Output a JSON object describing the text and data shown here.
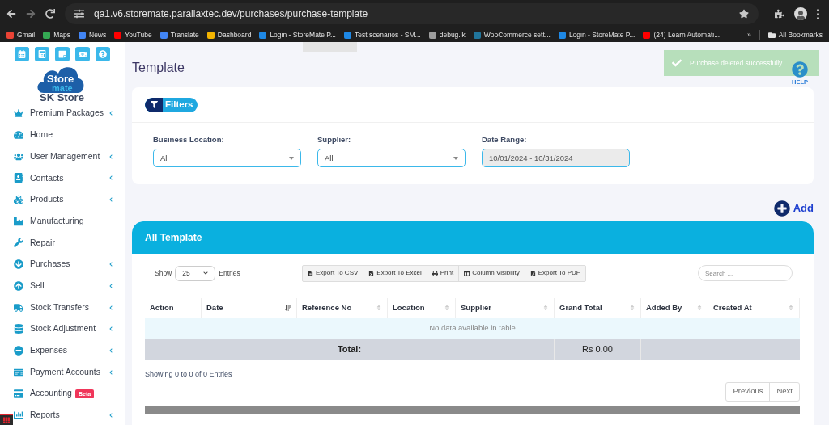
{
  "browser": {
    "url": "qa1.v6.storemate.parallaxtec.dev/purchases/purchase-template",
    "bookmarks": [
      {
        "label": "Gmail",
        "color": "#ea4335"
      },
      {
        "label": "Maps",
        "color": "#34a853"
      },
      {
        "label": "News",
        "color": "#4285f4"
      },
      {
        "label": "YouTube",
        "color": "#ff0000"
      },
      {
        "label": "Translate",
        "color": "#4285f4"
      },
      {
        "label": "Dashboard",
        "color": "#f4b400"
      },
      {
        "label": "Login - StoreMate P...",
        "color": "#1e88e5"
      },
      {
        "label": "Test scenarios - SM...",
        "color": "#1e88e5"
      },
      {
        "label": "debug.lk",
        "color": "#9e9e9e"
      },
      {
        "label": "WooCommerce sett...",
        "color": "#21759b"
      },
      {
        "label": "Login - StoreMate P...",
        "color": "#1e88e5"
      },
      {
        "label": "(24) Learn Automati...",
        "color": "#ff0000"
      }
    ],
    "more": "»",
    "all_bookmarks": "All Bookmarks"
  },
  "sidebar": {
    "logo_top": "Store",
    "logo_bottom": "mate",
    "store_name": "SK Store",
    "items": [
      {
        "label": "Premium Packages",
        "has_submenu": true
      },
      {
        "label": "Home",
        "has_submenu": false
      },
      {
        "label": "User Management",
        "has_submenu": true
      },
      {
        "label": "Contacts",
        "has_submenu": true
      },
      {
        "label": "Products",
        "has_submenu": true
      },
      {
        "label": "Manufacturing",
        "has_submenu": false
      },
      {
        "label": "Repair",
        "has_submenu": false
      },
      {
        "label": "Purchases",
        "has_submenu": true
      },
      {
        "label": "Sell",
        "has_submenu": true
      },
      {
        "label": "Stock Transfers",
        "has_submenu": true
      },
      {
        "label": "Stock Adjustment",
        "has_submenu": true
      },
      {
        "label": "Expenses",
        "has_submenu": true
      },
      {
        "label": "Payment Accounts",
        "has_submenu": true
      },
      {
        "label": "Accounting",
        "has_submenu": false,
        "badge": "Beta"
      },
      {
        "label": "Reports",
        "has_submenu": true
      }
    ]
  },
  "page_title": "Template",
  "toast": {
    "message": "Purchase deleted successfully"
  },
  "help": "HELP",
  "filters": {
    "button": "Filters",
    "fields": [
      {
        "label": "Business Location:",
        "value": "All",
        "kind": "select"
      },
      {
        "label": "Supplier:",
        "value": "All",
        "kind": "select"
      },
      {
        "label": "Date Range:",
        "value": "10/01/2024 - 10/31/2024",
        "kind": "readonly"
      }
    ]
  },
  "add_button": "Add",
  "table_card": {
    "title": "All Template",
    "show_label": "Show",
    "page_size": "25",
    "entries_label": "Entries",
    "exports": [
      "Export To CSV",
      "Export To Excel",
      "Print",
      "Column Visibility",
      "Export To PDF"
    ],
    "search_placeholder": "Search ...",
    "columns": [
      {
        "label": "Action",
        "kind": "plain"
      },
      {
        "label": "Date",
        "kind": "sorted"
      },
      {
        "label": "Reference No",
        "kind": "sortable"
      },
      {
        "label": "Location",
        "kind": "sortable"
      },
      {
        "label": "Supplier",
        "kind": "sortable"
      },
      {
        "label": "Grand Total",
        "kind": "sortable"
      },
      {
        "label": "Added By",
        "kind": "sortable"
      },
      {
        "label": "Created At",
        "kind": "sortable"
      }
    ],
    "empty_message": "No data available in table",
    "total_label": "Total:",
    "total_value": "Rs 0.00",
    "info": "Showing 0 to 0 of 0 Entries",
    "pagination": [
      "Previous",
      "Next"
    ]
  }
}
